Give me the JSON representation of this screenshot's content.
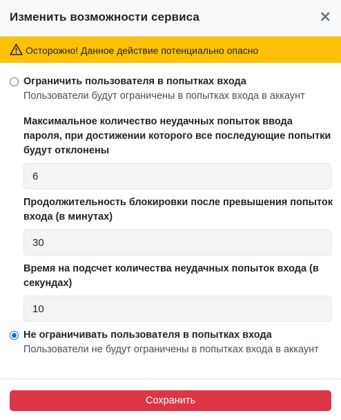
{
  "modal": {
    "title": "Изменить возможности сервиса",
    "close_symbol": "×"
  },
  "warning": {
    "text": "Осторожно! Данное действие потенциально опасно",
    "icon": "warning-triangle-icon",
    "background": "#ffc107"
  },
  "options": [
    {
      "title": "Ограничить пользователя в попытках входа",
      "description": "Пользователи будут ограничены в попытках входа в аккаунт",
      "selected": false
    },
    {
      "title": "Не ограничивать пользователя в попытках входа",
      "description": "Пользователи не будут ограничены в попытках входа в аккаунт",
      "selected": true
    }
  ],
  "fields": [
    {
      "label": "Максимальное количество неудачных попыток ввода пароля, при достижении которого все последующие попытки будут отклонены",
      "value": "6"
    },
    {
      "label": "Продолжительность блокировки после превышения попыток входа (в минутах)",
      "value": "30"
    },
    {
      "label": "Время на подсчет количества неудачных попыток входа (в секундах)",
      "value": "10"
    }
  ],
  "footer": {
    "save_label": "Сохранить",
    "save_color": "#dc3545"
  },
  "accent_color": "#0d6efd"
}
